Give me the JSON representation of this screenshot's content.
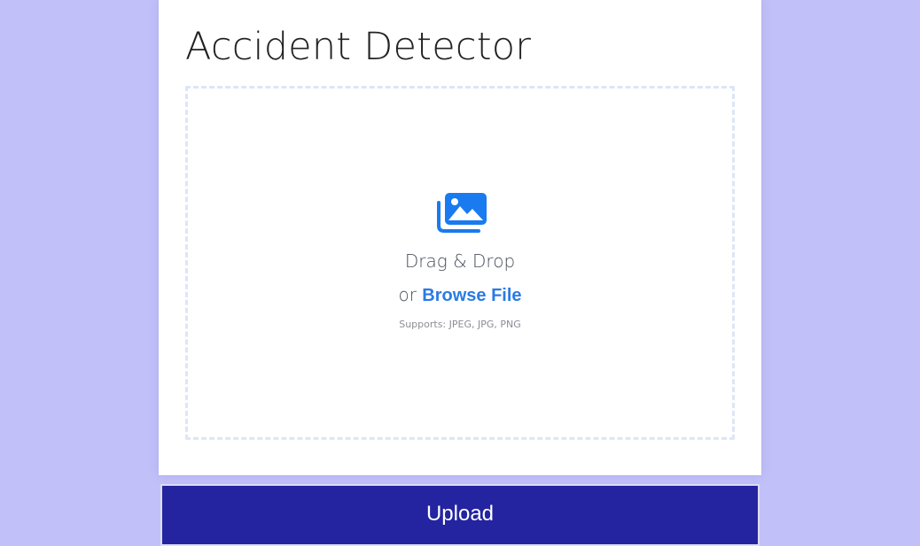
{
  "card": {
    "title": "Accident Detector"
  },
  "dropzone": {
    "icon": "image-gallery-icon",
    "main_text": "Drag & Drop",
    "or_text": "or",
    "browse_label": "Browse File",
    "supports_text": "Supports: JPEG, JPG, PNG"
  },
  "upload": {
    "label": "Upload"
  },
  "colors": {
    "background": "#c1c0f8",
    "accent": "#2a7be4",
    "button": "#2424a0"
  }
}
